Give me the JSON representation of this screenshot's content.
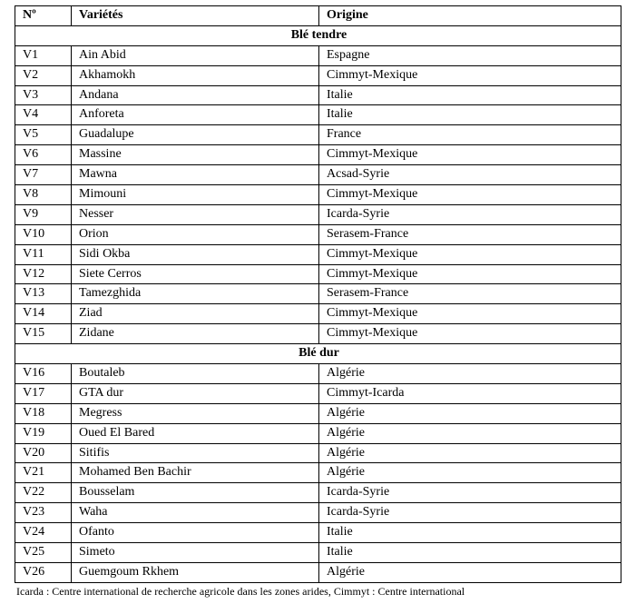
{
  "header": {
    "num": "Nº",
    "var": "Variétés",
    "ori": "Origine"
  },
  "sections": {
    "tendre": "Blé tendre",
    "dur": "Blé dur"
  },
  "rows_tendre": [
    {
      "n": "V1",
      "v": "Ain Abid",
      "o": "Espagne"
    },
    {
      "n": "V2",
      "v": "Akhamokh",
      "o": "Cimmyt-Mexique"
    },
    {
      "n": "V3",
      "v": "Andana",
      "o": "Italie"
    },
    {
      "n": "V4",
      "v": "Anforeta",
      "o": "Italie"
    },
    {
      "n": "V5",
      "v": "Guadalupe",
      "o": "France"
    },
    {
      "n": "V6",
      "v": "Massine",
      "o": "Cimmyt-Mexique"
    },
    {
      "n": "V7",
      "v": "Mawna",
      "o": "Acsad-Syrie"
    },
    {
      "n": "V8",
      "v": "Mimouni",
      "o": "Cimmyt-Mexique"
    },
    {
      "n": "V9",
      "v": "Nesser",
      "o": "Icarda-Syrie"
    },
    {
      "n": "V10",
      "v": "Orion",
      "o": "Serasem-France"
    },
    {
      "n": "V11",
      "v": "Sidi Okba",
      "o": "Cimmyt-Mexique"
    },
    {
      "n": "V12",
      "v": "Siete Cerros",
      "o": "Cimmyt-Mexique"
    },
    {
      "n": "V13",
      "v": "Tamezghida",
      "o": "Serasem-France"
    },
    {
      "n": "V14",
      "v": "Ziad",
      "o": "Cimmyt-Mexique"
    },
    {
      "n": "V15",
      "v": "Zidane",
      "o": "Cimmyt-Mexique"
    }
  ],
  "rows_dur": [
    {
      "n": "V16",
      "v": "Boutaleb",
      "o": "Algérie"
    },
    {
      "n": "V17",
      "v": "GTA dur",
      "o": "Cimmyt-Icarda"
    },
    {
      "n": "V18",
      "v": "Megress",
      "o": "Algérie"
    },
    {
      "n": "V19",
      "v": "Oued El Bared",
      "o": "Algérie"
    },
    {
      "n": "V20",
      "v": "Sitifis",
      "o": "Algérie"
    },
    {
      "n": "V21",
      "v": "Mohamed Ben Bachir",
      "o": "Algérie"
    },
    {
      "n": "V22",
      "v": "Bousselam",
      "o": "Icarda-Syrie"
    },
    {
      "n": "V23",
      "v": "Waha",
      "o": "Icarda-Syrie"
    },
    {
      "n": "V24",
      "v": "Ofanto",
      "o": "Italie"
    },
    {
      "n": "V25",
      "v": "Simeto",
      "o": "Italie"
    },
    {
      "n": "V26",
      "v": "Guemgoum Rkhem",
      "o": "Algérie"
    }
  ],
  "footnote": "Icarda :  Centre  international  de  recherche  agricole  dans  les  zones  arides,  Cimmyt :  Centre  international"
}
